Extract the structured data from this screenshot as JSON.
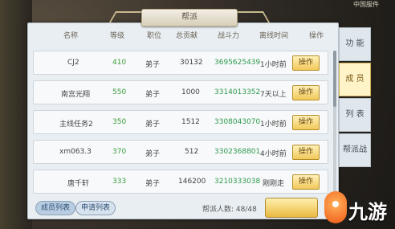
{
  "window": {
    "title": "帮派",
    "top_hint": "中国服件"
  },
  "columns": {
    "name": "名称",
    "level": "等级",
    "position": "职位",
    "contribution": "总贡献",
    "power": "战斗力",
    "offline": "离线时间",
    "action": "操作"
  },
  "rows": [
    {
      "name": "CJ2",
      "level": "410",
      "position": "弟子",
      "contribution": "30132",
      "power": "3695625439",
      "offline": "1小时前",
      "action": "操作"
    },
    {
      "name": "南宫光翔",
      "level": "550",
      "position": "弟子",
      "contribution": "1000",
      "power": "3314013352",
      "offline": "7天以上",
      "action": "操作"
    },
    {
      "name": "主线任务2",
      "level": "350",
      "position": "弟子",
      "contribution": "1512",
      "power": "3308043070",
      "offline": "1小时前",
      "action": "操作"
    },
    {
      "name": "xm063.3",
      "level": "370",
      "position": "弟子",
      "contribution": "512",
      "power": "3302368801",
      "offline": "4小时前",
      "action": "操作"
    },
    {
      "name": "唐千轩",
      "level": "333",
      "position": "弟子",
      "contribution": "146200",
      "power": "3210333038",
      "offline": "刚刚走",
      "action": "操作"
    }
  ],
  "bottom": {
    "tab_members": "成员列表",
    "tab_applications": "申请列表",
    "member_count": "帮派人数: 48/48"
  },
  "side_tabs": [
    "功 能",
    "成 员",
    "列 表",
    "帮派战"
  ],
  "watermark": {
    "text": "九游"
  },
  "colors": {
    "level": "#3c9c3c",
    "power": "#2f9a4f",
    "action_button": "#f2c85a",
    "active_side_tab": "#fff3c8"
  }
}
